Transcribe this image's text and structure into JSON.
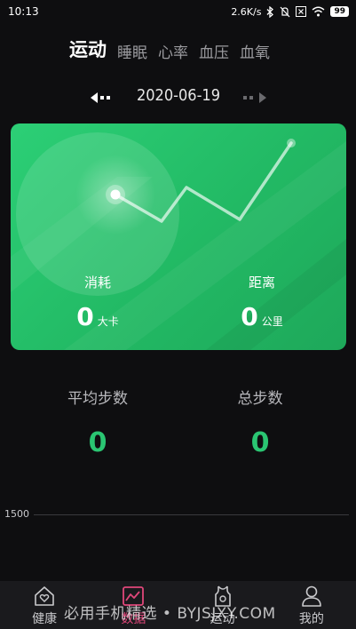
{
  "status_bar": {
    "time": "10:13",
    "speed": "2.6K/s",
    "battery": "99",
    "icons": [
      "bluetooth-icon",
      "mute-icon",
      "close-box-icon",
      "wifi-icon",
      "battery-icon"
    ]
  },
  "tabs": [
    {
      "label": "运动",
      "active": true
    },
    {
      "label": "睡眠",
      "active": false
    },
    {
      "label": "心率",
      "active": false
    },
    {
      "label": "血压",
      "active": false
    },
    {
      "label": "血氧",
      "active": false
    }
  ],
  "date": "2020-06-19",
  "card": {
    "consumption_label": "消耗",
    "consumption_value": "0",
    "consumption_unit": "大卡",
    "distance_label": "距离",
    "distance_value": "0",
    "distance_unit": "公里"
  },
  "totals": {
    "avg_steps_label": "平均步数",
    "avg_steps_value": "0",
    "total_steps_label": "总步数",
    "total_steps_value": "0"
  },
  "chart": {
    "tick": "1500"
  },
  "nav": [
    {
      "label": "健康",
      "icon": "heart-home-icon",
      "active": false
    },
    {
      "label": "数据",
      "icon": "data-chart-icon",
      "active": true
    },
    {
      "label": "运动",
      "icon": "sport-vest-icon",
      "active": false
    },
    {
      "label": "我的",
      "icon": "person-icon",
      "active": false
    }
  ],
  "watermark": "必用手机精选 • BYJSJXY.COM",
  "colors": {
    "accent_green": "#2ac572",
    "card_green": "#22b964",
    "active_nav": "#e0477a",
    "background": "#0e0e10"
  }
}
